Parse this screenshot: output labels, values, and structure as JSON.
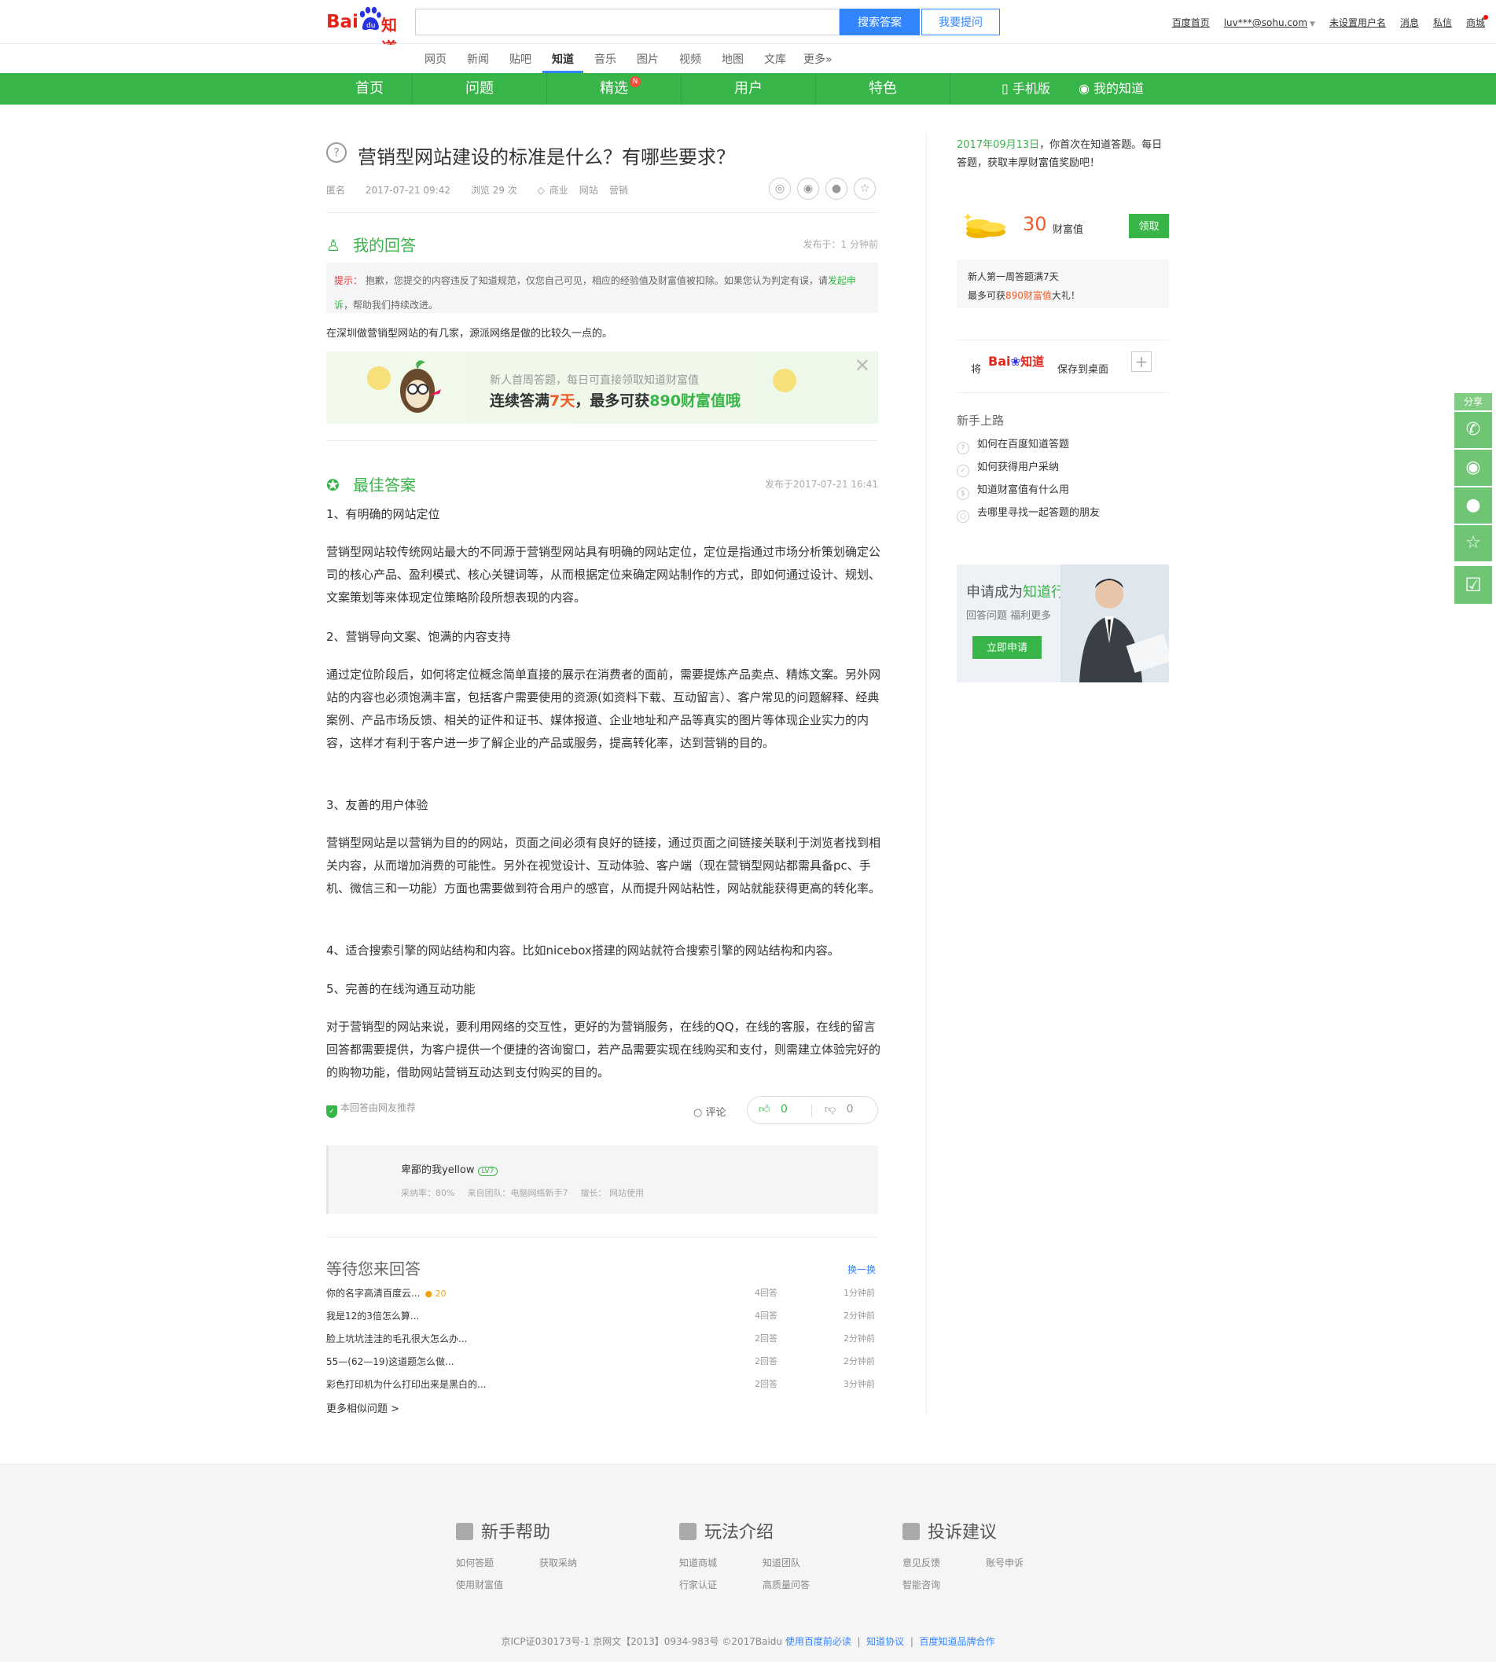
{
  "header": {
    "logo_text_bai": "Bai",
    "logo_text_zhidao": "知道",
    "search_placeholder": "",
    "search_button": "搜索答案",
    "ask_button": "我要提问",
    "links": [
      "百度首页",
      "luv***@sohu.com",
      "未设置用户名",
      "消息",
      "私信",
      "商城"
    ]
  },
  "channels": [
    "网页",
    "新闻",
    "贴吧",
    "知道",
    "音乐",
    "图片",
    "视频",
    "地图",
    "文库",
    "更多»"
  ],
  "green_nav": {
    "items": [
      "首页",
      "问题",
      "精选",
      "用户",
      "特色"
    ],
    "badge": "N",
    "mobile": "手机版",
    "my_zhidao": "我的知道"
  },
  "question": {
    "title": "营销型网站建设的标准是什么？有哪些要求？",
    "asker": "匿名",
    "date": "2017-07-21 09:42",
    "views": "浏览 29 次",
    "tags": [
      "商业",
      "网站",
      "营销"
    ]
  },
  "my_answer": {
    "heading": "我的回答",
    "time": "发布于：1 分钟前",
    "notice_label": "提示：",
    "notice_text": "抱歉，您提交的内容违反了知道规范，仅您自己可见，相应的经验值及财富值被扣除。如果您认为判定有误，请",
    "notice_link": "发起申诉",
    "notice_tail": "，帮助我们持续改进。",
    "content": "在深圳做营销型网站的有几家，源派网络是做的比较久一点的。"
  },
  "promo": {
    "line1": "新人首周答题，每日可直接领取知道财富值",
    "line2_a": "连续答满",
    "line2_b": "7天",
    "line2_c": "，最多可获",
    "line2_d": "890财富值",
    "line2_e": "哦"
  },
  "best_answer": {
    "heading": "最佳答案",
    "time": "发布于2017-07-21 16:41",
    "paragraphs": [
      "1、有明确的网站定位",
      "营销型网站较传统网站最大的不同源于营销型网站具有明确的网站定位，定位是指通过市场分析策划确定公司的核心产品、盈利模式、核心关键词等，从而根据定位来确定网站制作的方式，即如何通过设计、规划、文案策划等来体现定位策略阶段所想表现的内容。",
      "2、营销导向文案、饱满的内容支持",
      "通过定位阶段后，如何将定位概念简单直接的展示在消费者的面前，需要提炼产品卖点、精炼文案。另外网站的内容也必须饱满丰富，包括客户需要使用的资源(如资料下载、互动留言）、客户常见的问题解释、经典案例、产品市场反馈、相关的证件和证书、媒体报道、企业地址和产品等真实的图片等体现企业实力的内容，这样才有利于客户进一步了解企业的产品或服务，提高转化率，达到营销的目的。",
      "3、友善的用户体验",
      "营销型网站是以营销为目的的网站，页面之间必须有良好的链接，通过页面之间链接关联利于浏览者找到相关内容，从而增加消费的可能性。另外在视觉设计、互动体验、客户端（现在营销型网站都需具备pc、手机、微信三和一功能）方面也需要做到符合用户的感官，从而提升网站粘性，网站就能获得更高的转化率。",
      "4、适合搜索引擎的网站结构和内容。比如nicebox搭建的网站就符合搜索引擎的网站结构和内容。",
      "5、完善的在线沟通互动功能",
      "对于营销型的网站来说，要利用网络的交互性，更好的为营销服务，在线的QQ，在线的客服，在线的留言回答都需要提供，为客户提供一个便捷的咨询窗口，若产品需要实现在线购买和支付，则需建立体验完好的的购物功能，借助网站营销互动达到支付购买的目的。"
    ],
    "recommended": "本回答由网友推荐",
    "comment": "评论",
    "up_count": "0",
    "down_count": "0"
  },
  "author": {
    "name": "卑鄙的我yellow",
    "level": "LV7",
    "adopt_rate": "采纳率：80%",
    "team": "来自团队：电脑网络新手7",
    "specialty": "擅长：  网站使用"
  },
  "waiting": {
    "title": "等待您来回答",
    "change": "换一换",
    "items": [
      {
        "q": "你的名字高清百度云...",
        "coin": "20",
        "count": "4回答",
        "time": "1分钟前"
      },
      {
        "q": "我是12的3倍怎么算...",
        "coin": "",
        "count": "4回答",
        "time": "2分钟前"
      },
      {
        "q": "脸上坑坑洼洼的毛孔很大怎么办...",
        "coin": "",
        "count": "2回答",
        "time": "2分钟前"
      },
      {
        "q": "55—(62—19)这道题怎么做...",
        "coin": "",
        "count": "2回答",
        "time": "2分钟前"
      },
      {
        "q": "彩色打印机为什么打印出来是黑白的...",
        "coin": "",
        "count": "2回答",
        "time": "3分钟前"
      }
    ],
    "more": "更多相似问题 >"
  },
  "sidebar": {
    "welcome_date": "2017年09月13日",
    "welcome_text": "，你首次在知道答题。每日答题，获取丰厚财富值奖励吧！",
    "coin_amount": "30",
    "coin_unit": "财富值",
    "claim": "领取",
    "week_line1": "新人第一周答题满7天",
    "week_line2_a": "最多可获",
    "week_line2_b": "890财富值",
    "week_line2_c": "大礼！",
    "save_a": "将",
    "save_b": "保存到桌面",
    "guide_title": "新手上路",
    "guide": [
      "如何在百度知道答题",
      "如何获得用户采纳",
      "知道财富值有什么用",
      "去哪里寻找一起答题的朋友"
    ],
    "expert_a": "申请成为",
    "expert_b": "知道行家",
    "expert_sub": "回答问题  福利更多",
    "expert_btn": "立即申请"
  },
  "float_share": {
    "label": "分享"
  },
  "footer": {
    "cols": [
      {
        "title": "新手帮助",
        "links": [
          "如何答题",
          "获取采纳",
          "使用财富值"
        ]
      },
      {
        "title": "玩法介绍",
        "links": [
          "知道商城",
          "知道团队",
          "行家认证",
          "高质量问答"
        ]
      },
      {
        "title": "投诉建议",
        "links": [
          "意见反馈",
          "账号申诉",
          "智能咨询"
        ]
      }
    ],
    "icp": "京ICP证030173号-1   京网文【2013】0934-983号     ©2017Baidu  ",
    "links": [
      "使用百度前必读",
      "知道协议",
      "百度知道品牌合作"
    ]
  },
  "colors": {
    "brand_green": "#38b548",
    "link_blue": "#3385ff",
    "accent_red": "#e1251b"
  }
}
